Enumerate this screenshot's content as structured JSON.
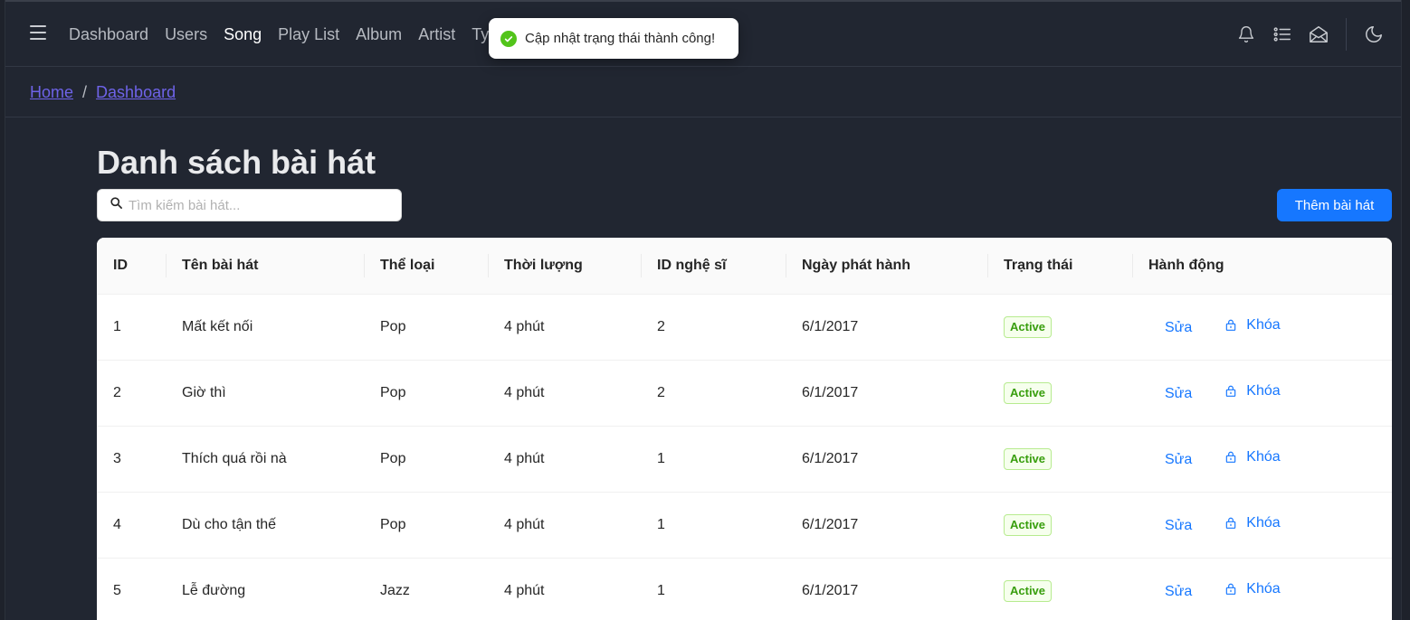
{
  "nav": {
    "items": [
      "Dashboard",
      "Users",
      "Song",
      "Play List",
      "Album",
      "Artist",
      "Typ"
    ],
    "active": "Song"
  },
  "toast": {
    "message": "Cập nhật trạng thái thành công!"
  },
  "breadcrumb": {
    "home": "Home",
    "separator": "/",
    "current": "Dashboard"
  },
  "page": {
    "title": "Danh sách bài hát"
  },
  "search": {
    "placeholder": "Tìm kiếm bài hát..."
  },
  "add_button": "Thêm bài hát",
  "table": {
    "headers": [
      "ID",
      "Tên bài hát",
      "Thể loại",
      "Thời lượng",
      "ID nghệ sĩ",
      "Ngày phát hành",
      "Trạng thái",
      "Hành động"
    ],
    "rows": [
      {
        "id": "1",
        "name": "Mất kết nối",
        "genre": "Pop",
        "duration": "4 phút",
        "artist_id": "2",
        "release": "6/1/2017",
        "status": "Active"
      },
      {
        "id": "2",
        "name": "Giờ thì",
        "genre": "Pop",
        "duration": "4 phút",
        "artist_id": "2",
        "release": "6/1/2017",
        "status": "Active"
      },
      {
        "id": "3",
        "name": "Thích quá rồi nà",
        "genre": "Pop",
        "duration": "4 phút",
        "artist_id": "1",
        "release": "6/1/2017",
        "status": "Active"
      },
      {
        "id": "4",
        "name": "Dù cho tận thế",
        "genre": "Pop",
        "duration": "4 phút",
        "artist_id": "1",
        "release": "6/1/2017",
        "status": "Active"
      },
      {
        "id": "5",
        "name": "Lễ đường",
        "genre": "Jazz",
        "duration": "4 phút",
        "artist_id": "1",
        "release": "6/1/2017",
        "status": "Active"
      }
    ],
    "actions": {
      "edit": "Sửa",
      "lock": "Khóa"
    }
  },
  "icons": [
    "hamburger-icon",
    "bell-icon",
    "list-icon",
    "mail-open-icon",
    "moon-icon",
    "check-circle-icon",
    "search-icon",
    "lock-icon"
  ],
  "colors": {
    "background": "#212631",
    "primary": "#1677ff",
    "link": "#6e63e8",
    "success": "#52c41a"
  }
}
